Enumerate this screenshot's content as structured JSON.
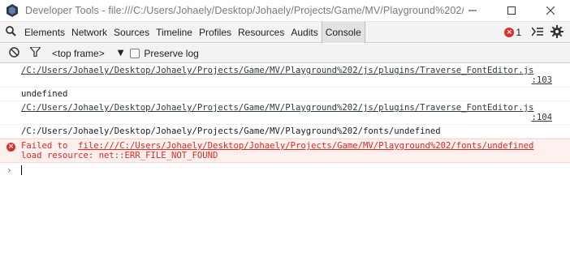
{
  "window": {
    "title": "Developer Tools - file:///C:/Users/Johaely/Desktop/Johaely/Projects/Game/MV/Playground%202/i..."
  },
  "tabs": [
    {
      "label": "Elements"
    },
    {
      "label": "Network"
    },
    {
      "label": "Sources"
    },
    {
      "label": "Timeline"
    },
    {
      "label": "Profiles"
    },
    {
      "label": "Resources"
    },
    {
      "label": "Audits"
    },
    {
      "label": "Console",
      "active": true
    }
  ],
  "toolbar": {
    "error_count": "1"
  },
  "console_toolbar": {
    "frame_label": "<top frame>",
    "preserve_log_label": "Preserve log"
  },
  "messages": [
    {
      "type": "source",
      "url": "/C:/Users/Johaely/Desktop/Johaely/Projects/Game/MV/Playground%202/js/plugins/Traverse_FontEditor.js",
      "line": ":103"
    },
    {
      "type": "log",
      "text": "undefined"
    },
    {
      "type": "source",
      "url": "/C:/Users/Johaely/Desktop/Johaely/Projects/Game/MV/Playground%202/js/plugins/Traverse_FontEditor.js",
      "line": ":104"
    },
    {
      "type": "log",
      "text": "/C:/Users/Johaely/Desktop/Johaely/Projects/Game/MV/Playground%202/fonts/undefined"
    },
    {
      "type": "error",
      "prefix": "Failed to  ",
      "url": "file:///C:/Users/Johaely/Desktop/Johaely/Projects/Game/MV/Playground%202/fonts/undefined",
      "detail": "load resource: net::ERR_FILE_NOT_FOUND"
    }
  ],
  "prompt": {
    "symbol": "›"
  },
  "colors": {
    "error": "#e0281d",
    "error_bg": "#fff0f0",
    "prompt": "#367cf1",
    "active_tab": "#e2e2e2"
  },
  "icons": [
    "devtools-app-icon",
    "minimize-icon",
    "maximize-icon",
    "close-icon",
    "search-icon",
    "error-icon",
    "console-drawer-icon",
    "gear-icon",
    "clear-console-icon",
    "filter-icon"
  ]
}
